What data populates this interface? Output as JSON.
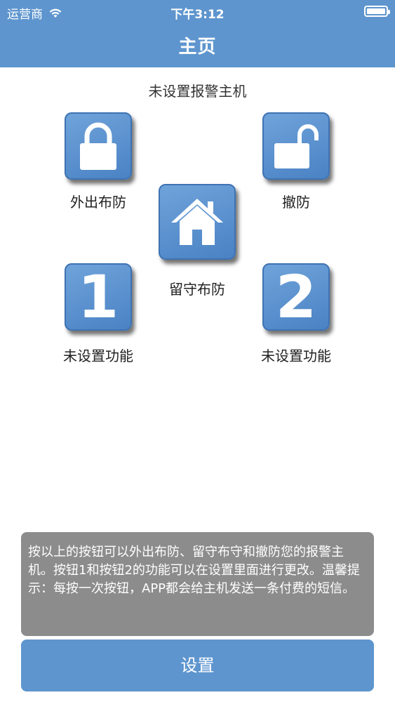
{
  "status_bar": {
    "carrier": "运营商",
    "time": "下午3:12"
  },
  "nav": {
    "title": "主页"
  },
  "host_status": "未设置报警主机",
  "tiles": {
    "arm_away": {
      "label": "外出布防",
      "icon": "lock-closed-icon"
    },
    "disarm": {
      "label": "撤防",
      "icon": "lock-open-icon"
    },
    "arm_home": {
      "label": "留守布防",
      "icon": "house-icon"
    },
    "func1": {
      "label": "未设置功能",
      "number": "1"
    },
    "func2": {
      "label": "未设置功能",
      "number": "2"
    }
  },
  "hint": "按以上的按钮可以外出布防、留守布守和撤防您的报警主机。按钮1和按钮2的功能可以在设置里面进行更改。温馨提示：每按一次按钮，APP都会给主机发送一条付费的短信。",
  "settings_button": "设置",
  "colors": {
    "accent": "#5e95ce",
    "tile": "#4a82c4",
    "hint_bg": "#8c8c8c"
  }
}
